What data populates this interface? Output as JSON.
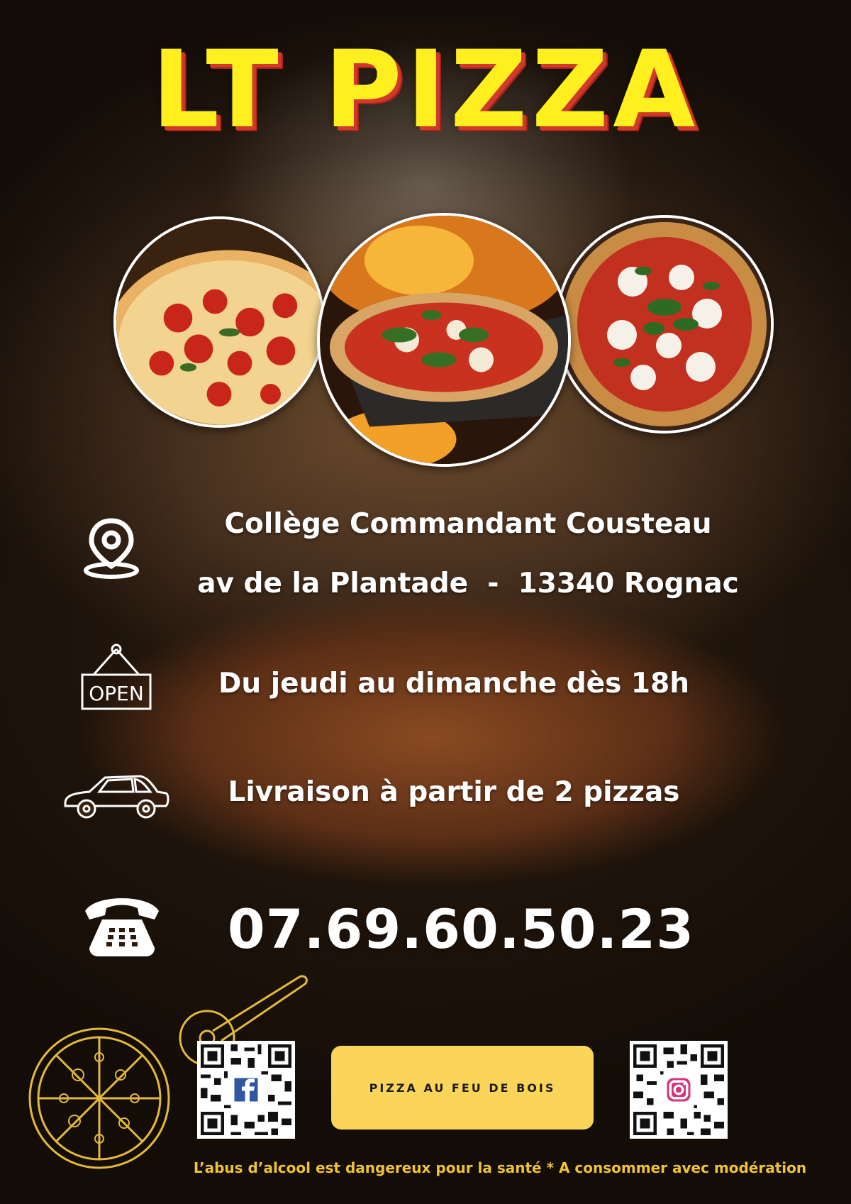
{
  "title": "LT PIZZA",
  "address": {
    "line1": "Collège Commandant Cousteau",
    "line2": "av de la Plantade  -  13340 Rognac"
  },
  "hours": "Du jeudi au dimanche dès 18h",
  "delivery": "Livraison à partir de 2 pizzas",
  "phone": "07.69.60.50.23",
  "badge": "PIZZA AU FEU DE BOIS",
  "disclaimer": "L’abus d’alcool est dangereux pour la santé * A consommer avec modération",
  "icons": {
    "location": "location-pin-icon",
    "open": "open-sign-icon",
    "car": "car-icon",
    "phone": "telephone-icon",
    "sketch": "pizza-sketch-icon",
    "facebook": "facebook-icon",
    "instagram": "instagram-icon"
  },
  "sign_text": "OPEN",
  "colors": {
    "title": "#ffef1f",
    "title_shadow": "#d2392a",
    "badge": "#fbd55a",
    "disclaimer": "#f0c337",
    "sketch": "#e2b93a"
  }
}
